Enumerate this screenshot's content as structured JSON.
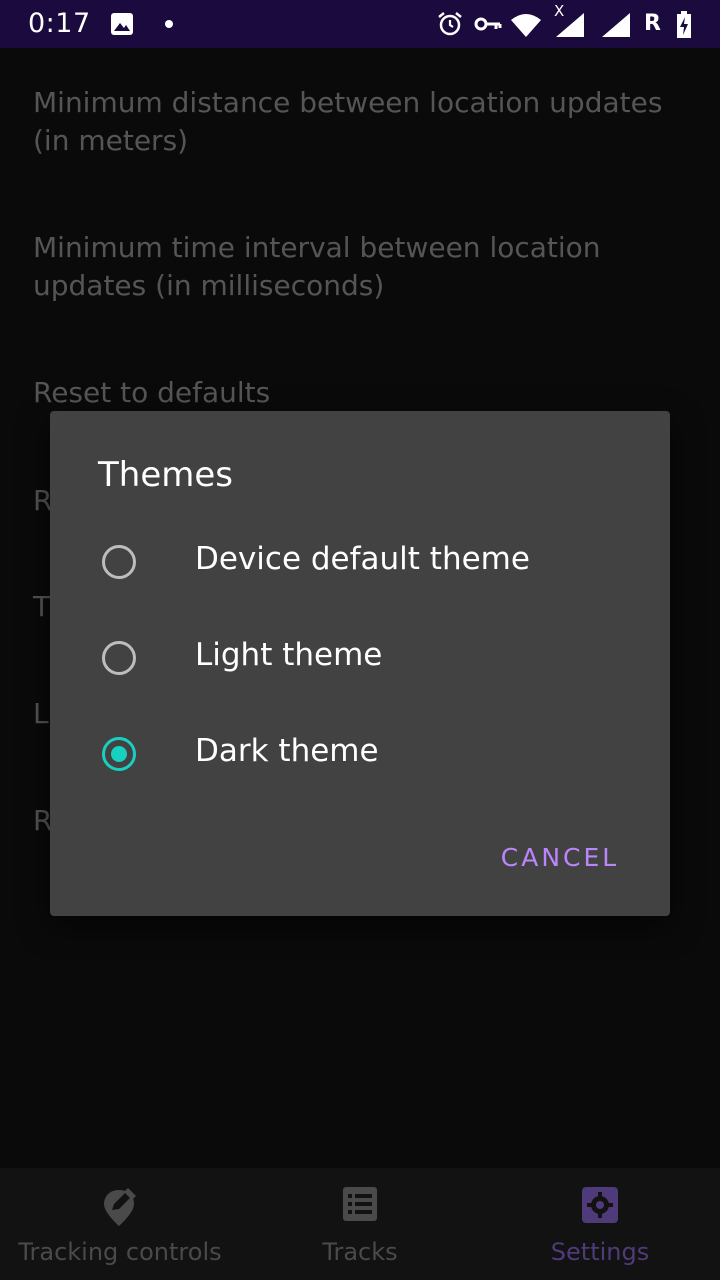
{
  "status_bar": {
    "time": "0:17",
    "carrier_letter": "R"
  },
  "settings": {
    "items": [
      {
        "label": "Minimum distance between location updates (in meters)"
      },
      {
        "label": "Minimum time interval between location updates (in milliseconds)"
      },
      {
        "label": "Reset to defaults"
      },
      {
        "label": "R"
      },
      {
        "label": "T"
      },
      {
        "label": "L"
      },
      {
        "label": "R"
      }
    ]
  },
  "dialog": {
    "title": "Themes",
    "options": [
      {
        "label": "Device default theme",
        "selected": false
      },
      {
        "label": "Light theme",
        "selected": false
      },
      {
        "label": "Dark theme",
        "selected": true
      }
    ],
    "cancel_label": "CANCEL"
  },
  "bottom_nav": {
    "items": [
      {
        "label": "Tracking controls",
        "icon": "location-edit-icon",
        "active": false
      },
      {
        "label": "Tracks",
        "icon": "list-icon",
        "active": false
      },
      {
        "label": "Settings",
        "icon": "gear-icon",
        "active": true
      }
    ]
  },
  "colors": {
    "status_bar": "#1a0a3d",
    "accent": "#bb86fc",
    "radio_checked": "#17d0c0",
    "dialog_bg": "#424242",
    "nav_active": "#4f3a7a"
  }
}
